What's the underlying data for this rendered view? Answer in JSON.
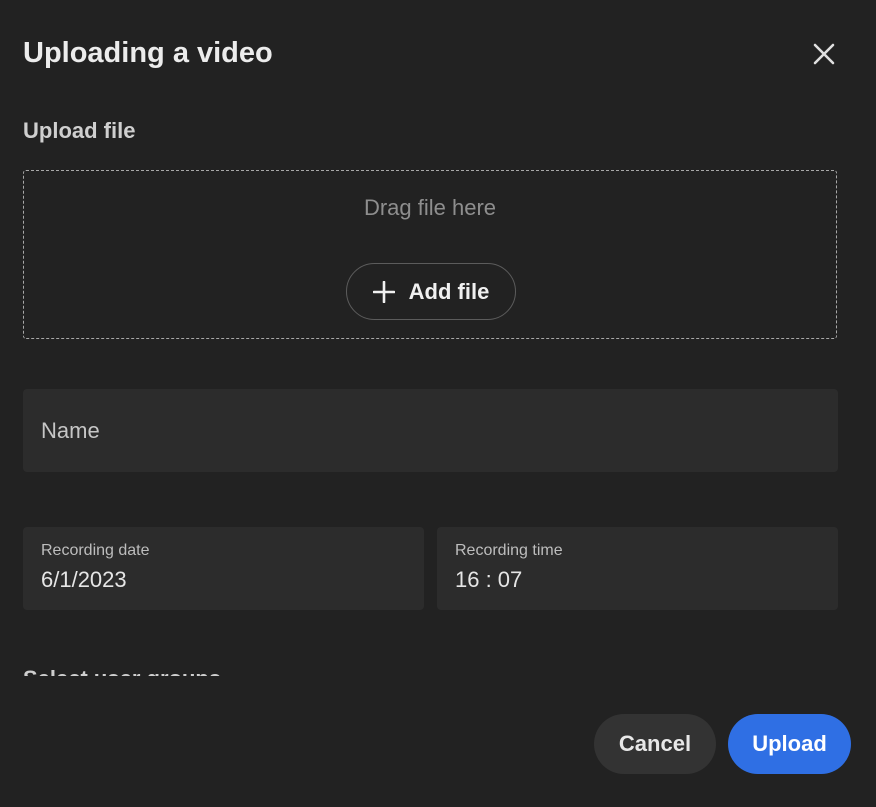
{
  "dialog": {
    "title": "Uploading a video",
    "close_icon": "close-icon"
  },
  "upload": {
    "section_label": "Upload file",
    "drop_hint": "Drag file here",
    "add_file_label": "Add file",
    "add_icon": "plus-icon"
  },
  "form": {
    "name_placeholder": "Name",
    "recording_date_label": "Recording date",
    "recording_date_value": "6/1/2023",
    "recording_time_label": "Recording time",
    "recording_time_value": "16 : 07",
    "user_groups_label": "Select user groups"
  },
  "actions": {
    "cancel_label": "Cancel",
    "upload_label": "Upload"
  },
  "colors": {
    "background": "#222222",
    "field_background": "#2c2c2c",
    "primary": "#2f6fe4",
    "secondary_button": "#333333"
  }
}
